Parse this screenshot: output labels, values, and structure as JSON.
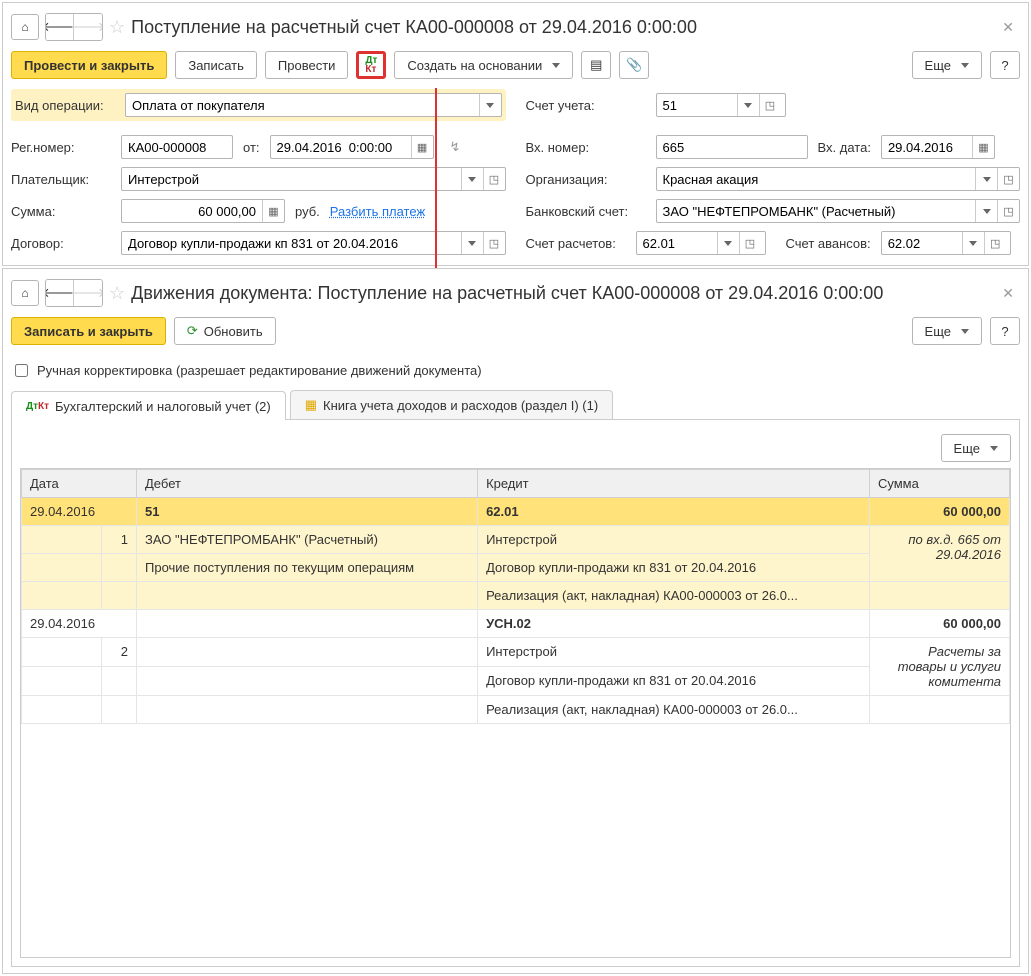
{
  "pane1": {
    "title": "Поступление на расчетный счет КА00-000008 от 29.04.2016 0:00:00",
    "toolbar": {
      "post_close": "Провести и закрыть",
      "save": "Записать",
      "post": "Провести",
      "create_based": "Создать на основании",
      "more": "Еще"
    },
    "fields": {
      "op_type_label": "Вид операции:",
      "op_type_value": "Оплата от покупателя",
      "account_label": "Счет учета:",
      "account_value": "51",
      "regnum_label": "Рег.номер:",
      "regnum_value": "КА00-000008",
      "from_label": "от:",
      "from_value": "29.04.2016  0:00:00",
      "in_num_label": "Вх. номер:",
      "in_num_value": "665",
      "in_date_label": "Вх. дата:",
      "in_date_value": "29.04.2016",
      "payer_label": "Плательщик:",
      "payer_value": "Интерстрой",
      "org_label": "Организация:",
      "org_value": "Красная акация",
      "sum_label": "Сумма:",
      "sum_value": "60 000,00",
      "sum_currency": "руб.",
      "split_link": "Разбить платеж",
      "bank_acc_label": "Банковский счет:",
      "bank_acc_value": "ЗАО \"НЕФТЕПРОМБАНК\" (Расчетный)",
      "contract_label": "Договор:",
      "contract_value": "Договор купли-продажи кп 831 от 20.04.2016",
      "calc_acc_label": "Счет расчетов:",
      "calc_acc_value": "62.01",
      "adv_acc_label": "Счет авансов:",
      "adv_acc_value": "62.02"
    }
  },
  "pane2": {
    "title": "Движения документа: Поступление на расчетный счет КА00-000008 от 29.04.2016 0:00:00",
    "toolbar": {
      "save_close": "Записать и закрыть",
      "refresh": "Обновить",
      "more": "Еще"
    },
    "manual_edit": "Ручная корректировка (разрешает редактирование движений документа)",
    "tabs": {
      "tab1": "Бухгалтерский и налоговый учет (2)",
      "tab2": "Книга учета доходов и расходов (раздел I) (1)"
    },
    "table": {
      "more": "Еще",
      "headers": {
        "date": "Дата",
        "debit": "Дебет",
        "credit": "Кредит",
        "sum": "Сумма"
      },
      "r1": {
        "date": "29.04.2016",
        "debit": "51",
        "credit": "62.01",
        "sum": "60 000,00"
      },
      "r2": {
        "num": "1",
        "debit": "ЗАО \"НЕФТЕПРОМБАНК\" (Расчетный)",
        "credit": "Интерстрой",
        "note": "по вх.д. 665 от 29.04.2016"
      },
      "r3": {
        "debit": "Прочие поступления по текущим операциям",
        "credit": "Договор купли-продажи кп 831 от 20.04.2016"
      },
      "r4": {
        "credit": "Реализация (акт, накладная) КА00-000003 от 26.0..."
      },
      "r5": {
        "date": "29.04.2016",
        "credit": "УСН.02",
        "sum": "60 000,00"
      },
      "r6": {
        "num": "2",
        "credit": "Интерстрой",
        "note": "Расчеты за товары и услуги комитента"
      },
      "r7": {
        "credit": "Договор купли-продажи кп 831 от 20.04.2016"
      },
      "r8": {
        "credit": "Реализация (акт, накладная) КА00-000003 от 26.0..."
      }
    }
  }
}
